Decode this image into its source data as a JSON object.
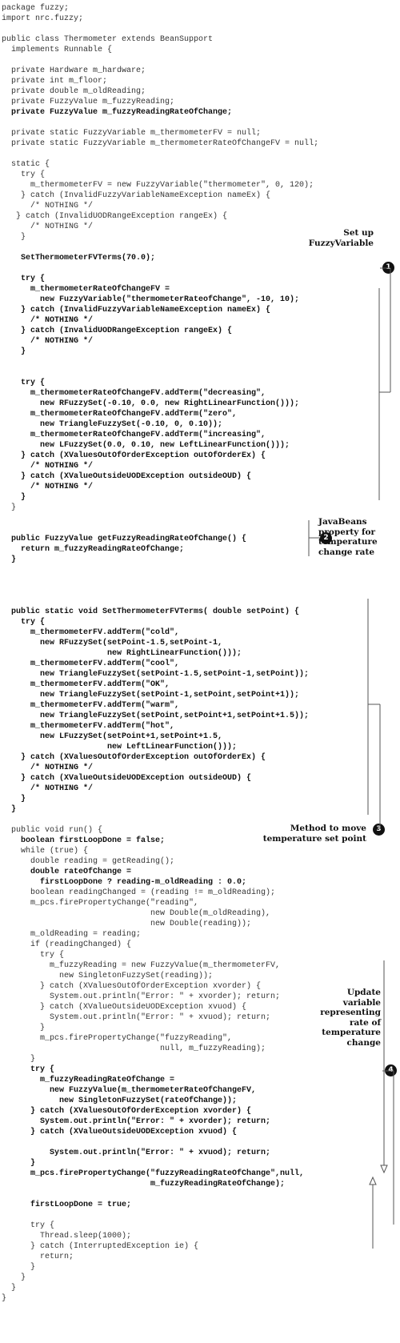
{
  "code_lines": [
    {
      "text": "package fuzzy;",
      "bold": false
    },
    {
      "text": "import nrc.fuzzy;",
      "bold": false
    },
    {
      "text": "",
      "bold": false
    },
    {
      "text": "public class Thermometer extends BeanSupport",
      "bold": false
    },
    {
      "text": "  implements Runnable {",
      "bold": false
    },
    {
      "text": "",
      "bold": false
    },
    {
      "text": "  private Hardware m_hardware;",
      "bold": false
    },
    {
      "text": "  private int m_floor;",
      "bold": false
    },
    {
      "text": "  private double m_oldReading;",
      "bold": false
    },
    {
      "text": "  private FuzzyValue m_fuzzyReading;",
      "bold": false
    },
    {
      "text": "  private FuzzyValue m_fuzzyReadingRateOfChange;",
      "bold": true
    },
    {
      "text": "",
      "bold": false
    },
    {
      "text": "  private static FuzzyVariable m_thermometerFV = null;",
      "bold": false
    },
    {
      "text": "  private static FuzzyVariable m_thermometerRateOfChangeFV = null;",
      "bold": false
    },
    {
      "text": "",
      "bold": false
    },
    {
      "text": "  static {",
      "bold": false
    },
    {
      "text": "    try {",
      "bold": false
    },
    {
      "text": "      m_thermometerFV = new FuzzyVariable(\"thermometer\", 0, 120);",
      "bold": false
    },
    {
      "text": "    } catch (InvalidFuzzyVariableNameException nameEx) {",
      "bold": false
    },
    {
      "text": "      /* NOTHING */",
      "bold": false
    },
    {
      "text": "   } catch (InvalidUODRangeException rangeEx) {",
      "bold": false
    },
    {
      "text": "      /* NOTHING */",
      "bold": false
    },
    {
      "text": "    }",
      "bold": false
    },
    {
      "text": "",
      "bold": false
    },
    {
      "text": "    SetThermometerFVTerms(70.0);",
      "bold": true
    },
    {
      "text": "",
      "bold": false
    },
    {
      "text": "    try {",
      "bold": true
    },
    {
      "text": "      m_thermometerRateOfChangeFV =",
      "bold": true
    },
    {
      "text": "        new FuzzyVariable(\"thermometerRateofChange\", -10, 10);",
      "bold": true
    },
    {
      "text": "    } catch (InvalidFuzzyVariableNameException nameEx) {",
      "bold": true
    },
    {
      "text": "      /* NOTHING */",
      "bold": true
    },
    {
      "text": "    } catch (InvalidUODRangeException rangeEx) {",
      "bold": true
    },
    {
      "text": "      /* NOTHING */",
      "bold": true
    },
    {
      "text": "    }",
      "bold": true
    },
    {
      "text": "",
      "bold": false
    },
    {
      "text": "",
      "bold": false
    },
    {
      "text": "    try {",
      "bold": true
    },
    {
      "text": "      m_thermometerRateOfChangeFV.addTerm(\"decreasing\",",
      "bold": true
    },
    {
      "text": "        new RFuzzySet(-0.10, 0.0, new RightLinearFunction()));",
      "bold": true
    },
    {
      "text": "      m_thermometerRateOfChangeFV.addTerm(\"zero\",",
      "bold": true
    },
    {
      "text": "        new TriangleFuzzySet(-0.10, 0, 0.10));",
      "bold": true
    },
    {
      "text": "      m_thermometerRateOfChangeFV.addTerm(\"increasing\",",
      "bold": true
    },
    {
      "text": "        new LFuzzySet(0.0, 0.10, new LeftLinearFunction()));",
      "bold": true
    },
    {
      "text": "    } catch (XValuesOutOfOrderException outOfOrderEx) {",
      "bold": true
    },
    {
      "text": "      /* NOTHING */",
      "bold": true
    },
    {
      "text": "    } catch (XValueOutsideUODException outsideOUD) {",
      "bold": true
    },
    {
      "text": "      /* NOTHING */",
      "bold": true
    },
    {
      "text": "    }",
      "bold": true
    },
    {
      "text": "  }",
      "bold": false
    },
    {
      "text": "",
      "bold": false
    },
    {
      "text": "",
      "bold": false
    },
    {
      "text": "  public FuzzyValue getFuzzyReadingRateOfChange() {",
      "bold": true
    },
    {
      "text": "    return m_fuzzyReadingRateOfChange;",
      "bold": true
    },
    {
      "text": "  }",
      "bold": true
    },
    {
      "text": "",
      "bold": false
    },
    {
      "text": "",
      "bold": false
    },
    {
      "text": "",
      "bold": false
    },
    {
      "text": "",
      "bold": false
    },
    {
      "text": "  public static void SetThermometerFVTerms( double setPoint) {",
      "bold": true
    },
    {
      "text": "    try {",
      "bold": true
    },
    {
      "text": "      m_thermometerFV.addTerm(\"cold\",",
      "bold": true
    },
    {
      "text": "        new RFuzzySet(setPoint-1.5,setPoint-1,",
      "bold": true
    },
    {
      "text": "                      new RightLinearFunction()));",
      "bold": true
    },
    {
      "text": "      m_thermometerFV.addTerm(\"cool\",",
      "bold": true
    },
    {
      "text": "        new TriangleFuzzySet(setPoint-1.5,setPoint-1,setPoint));",
      "bold": true
    },
    {
      "text": "      m_thermometerFV.addTerm(\"OK\",",
      "bold": true
    },
    {
      "text": "        new TriangleFuzzySet(setPoint-1,setPoint,setPoint+1));",
      "bold": true
    },
    {
      "text": "      m_thermometerFV.addTerm(\"warm\",",
      "bold": true
    },
    {
      "text": "        new TriangleFuzzySet(setPoint,setPoint+1,setPoint+1.5));",
      "bold": true
    },
    {
      "text": "      m_thermometerFV.addTerm(\"hot\",",
      "bold": true
    },
    {
      "text": "        new LFuzzySet(setPoint+1,setPoint+1.5,",
      "bold": true
    },
    {
      "text": "                      new LeftLinearFunction()));",
      "bold": true
    },
    {
      "text": "    } catch (XValuesOutOfOrderException outOfOrderEx) {",
      "bold": true
    },
    {
      "text": "      /* NOTHING */",
      "bold": true
    },
    {
      "text": "    } catch (XValueOutsideUODException outsideOUD) {",
      "bold": true
    },
    {
      "text": "      /* NOTHING */",
      "bold": true
    },
    {
      "text": "    }",
      "bold": true
    },
    {
      "text": "  }",
      "bold": true
    },
    {
      "text": "",
      "bold": false
    },
    {
      "text": "  public void run() {",
      "bold": false
    },
    {
      "text": "    boolean firstLoopDone = false;",
      "bold": true
    },
    {
      "text": "    while (true) {",
      "bold": false
    },
    {
      "text": "      double reading = getReading();",
      "bold": false
    },
    {
      "text": "      double rateOfChange =",
      "bold": true
    },
    {
      "text": "        firstLoopDone ? reading-m_oldReading : 0.0;",
      "bold": true
    },
    {
      "text": "      boolean readingChanged = (reading != m_oldReading);",
      "bold": false
    },
    {
      "text": "      m_pcs.firePropertyChange(\"reading\",",
      "bold": false
    },
    {
      "text": "                               new Double(m_oldReading),",
      "bold": false
    },
    {
      "text": "                               new Double(reading));",
      "bold": false
    },
    {
      "text": "      m_oldReading = reading;",
      "bold": false
    },
    {
      "text": "      if (readingChanged) {",
      "bold": false
    },
    {
      "text": "        try {",
      "bold": false
    },
    {
      "text": "          m_fuzzyReading = new FuzzyValue(m_thermometerFV,",
      "bold": false
    },
    {
      "text": "            new SingletonFuzzySet(reading));",
      "bold": false
    },
    {
      "text": "        } catch (XValuesOutOfOrderException xvorder) {",
      "bold": false
    },
    {
      "text": "          System.out.println(\"Error: \" + xvorder); return;",
      "bold": false
    },
    {
      "text": "        } catch (XValueOutsideUODException xvuod) {",
      "bold": false
    },
    {
      "text": "          System.out.println(\"Error: \" + xvuod); return;",
      "bold": false
    },
    {
      "text": "        }",
      "bold": false
    },
    {
      "text": "        m_pcs.firePropertyChange(\"fuzzyReading\",",
      "bold": false
    },
    {
      "text": "                                 null, m_fuzzyReading);",
      "bold": false
    },
    {
      "text": "      }",
      "bold": false
    },
    {
      "text": "      try {",
      "bold": true
    },
    {
      "text": "        m_fuzzyReadingRateOfChange =",
      "bold": true
    },
    {
      "text": "          new FuzzyValue(m_thermometerRateOfChangeFV,",
      "bold": true
    },
    {
      "text": "            new SingletonFuzzySet(rateOfChange));",
      "bold": true
    },
    {
      "text": "      } catch (XValuesOutOfOrderException xvorder) {",
      "bold": true
    },
    {
      "text": "        System.out.println(\"Error: \" + xvorder); return;",
      "bold": true
    },
    {
      "text": "      } catch (XValueOutsideUODException xvuod) {",
      "bold": true
    },
    {
      "text": "",
      "bold": false
    },
    {
      "text": "          System.out.println(\"Error: \" + xvuod); return;",
      "bold": true
    },
    {
      "text": "      }",
      "bold": true
    },
    {
      "text": "      m_pcs.firePropertyChange(\"fuzzyReadingRateOfChange\",null,",
      "bold": true
    },
    {
      "text": "                               m_fuzzyReadingRateOfChange);",
      "bold": true
    },
    {
      "text": "",
      "bold": false
    },
    {
      "text": "      firstLoopDone = true;",
      "bold": true
    },
    {
      "text": "",
      "bold": false
    },
    {
      "text": "      try {",
      "bold": false
    },
    {
      "text": "        Thread.sleep(1000);",
      "bold": false
    },
    {
      "text": "      } catch (InterruptedException ie) {",
      "bold": false
    },
    {
      "text": "        return;",
      "bold": false
    },
    {
      "text": "      }",
      "bold": false
    },
    {
      "text": "    }",
      "bold": false
    },
    {
      "text": "  }",
      "bold": false
    },
    {
      "text": "}",
      "bold": false
    }
  ],
  "annotations": [
    {
      "number": "1",
      "label": "Set up\nFuzzyVariable"
    },
    {
      "number": "2",
      "label": "JavaBeans\nproperty for\ntemperature\nchange rate"
    },
    {
      "number": "3",
      "label": "Method to move\ntemperature set point"
    },
    {
      "number": "4",
      "label": "Update\nvariable\nrepresenting\nrate of\ntemperature\nchange"
    }
  ]
}
